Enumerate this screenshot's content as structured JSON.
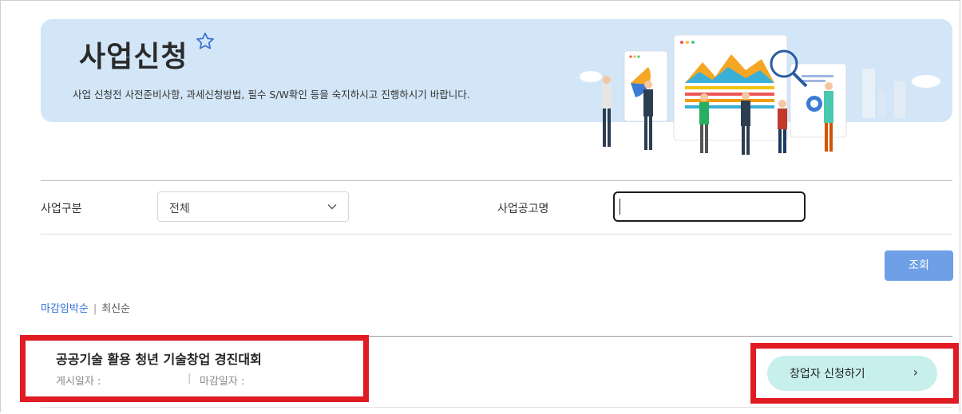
{
  "banner": {
    "title": "사업신청",
    "description": "사업 신청전 사전준비사항, 과세신청방법, 필수 S/W확인 등을 숙지하시고 진행하시기 바랍니다."
  },
  "filters": {
    "category_label": "사업구분",
    "category_value": "전체",
    "notice_label": "사업공고명",
    "notice_value": "",
    "search_button": "조회"
  },
  "sort": {
    "active": "마감임박순",
    "separator": "|",
    "inactive": "최신순"
  },
  "list": {
    "items": [
      {
        "title": "공공기술 활용 청년 기술창업 경진대회",
        "posted_label": "게시일자 :",
        "separator": "|",
        "deadline_label": "마감일자 :",
        "apply_label": "창업자 신청하기",
        "apply_arrow": "›"
      }
    ]
  },
  "colors": {
    "banner_bg": "#d3e6f8",
    "search_button": "#6f9fe6",
    "apply_button": "#c7f0ec",
    "active_sort": "#2f6fd6",
    "highlight": "#e01b24"
  },
  "icons": [
    "star-icon",
    "chevron-down-icon",
    "chevron-right-icon"
  ]
}
